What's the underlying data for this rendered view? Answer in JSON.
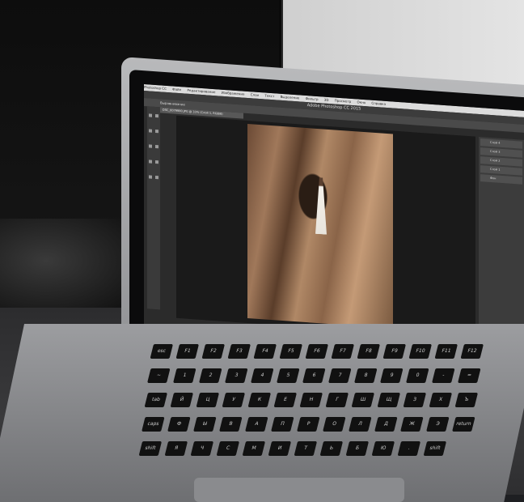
{
  "screen": {
    "app_title": "Adobe Photoshop CC 2015",
    "menu_items": [
      "Photoshop CC",
      "Файл",
      "Редактирование",
      "Изображение",
      "Слои",
      "Текст",
      "Выделение",
      "Фильтр",
      "3D",
      "Просмотр",
      "Окно",
      "Справка"
    ],
    "options_label": "Выравнивание",
    "doc_tab": "DSC_0079980.JPG @ 33% (Слой 1, RGB/8)",
    "layers": [
      "Слой 4",
      "Слой 3",
      "Слой 2",
      "Слой 1",
      "Фон"
    ]
  },
  "keyboard": {
    "row1": [
      "esc",
      "F1",
      "F2",
      "F3",
      "F4",
      "F5",
      "F6",
      "F7",
      "F8",
      "F9",
      "F10",
      "F11",
      "F12"
    ],
    "row2": [
      "~",
      "1",
      "2",
      "3",
      "4",
      "5",
      "6",
      "7",
      "8",
      "9",
      "0",
      "-",
      "="
    ],
    "row3": [
      "tab",
      "Й",
      "Ц",
      "У",
      "К",
      "Е",
      "Н",
      "Г",
      "Ш",
      "Щ",
      "З",
      "Х",
      "Ъ"
    ],
    "row4": [
      "caps",
      "Ф",
      "Ы",
      "В",
      "А",
      "П",
      "Р",
      "О",
      "Л",
      "Д",
      "Ж",
      "Э",
      "return"
    ],
    "row5": [
      "shift",
      "Я",
      "Ч",
      "С",
      "М",
      "И",
      "Т",
      "Ь",
      "Б",
      "Ю",
      ".",
      "shift"
    ]
  }
}
